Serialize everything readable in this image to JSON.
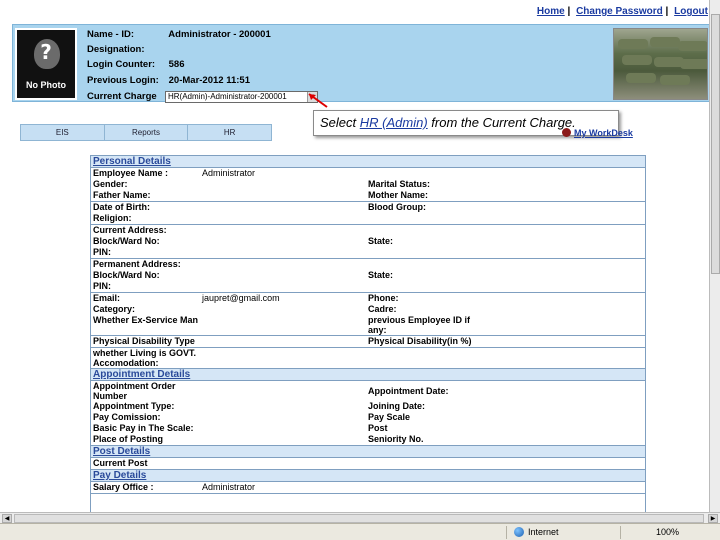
{
  "top_links": [
    "Home",
    "Change Password",
    "Logout"
  ],
  "header": {
    "photo_label": "No Photo",
    "photo_glyph": "?",
    "fields": [
      {
        "label": "Name - ID:",
        "value": "Administrator - 200001"
      },
      {
        "label": "Designation:",
        "value": ""
      },
      {
        "label": "Login Counter:",
        "value": "586"
      },
      {
        "label": "Previous Login:",
        "value": "20-Mar-2012 11:51"
      },
      {
        "label": "Current Charge",
        "value": ""
      }
    ],
    "charge_select_value": "HR(Admin)-Administrator-200001"
  },
  "callout": {
    "prefix": "Select ",
    "highlight": "HR (Admin)",
    "suffix": " from the Current Charge."
  },
  "tabs": [
    "EIS",
    "Reports",
    "HR"
  ],
  "my_desk": "My WorkDesk",
  "form": {
    "personal_title": "Personal Details",
    "appointment_title": "Appointment Details",
    "post_title": "Post Details",
    "pay_title": "Pay Details",
    "employee_name_label": "Employee Name :",
    "employee_name_value": "Administrator",
    "gender_label": "Gender:",
    "marital_label": "Marital Status:",
    "father_label": "Father Name:",
    "mother_label": "Mother Name:",
    "dob_label": "Date of Birth:",
    "blood_label": "Blood Group:",
    "religion_label": "Religion:",
    "cur_addr_label": "Current Address:",
    "cur_block_label": "Block/Ward No:",
    "cur_state_label": "State:",
    "cur_pin_label": "PIN:",
    "perm_addr_label": "Permanent Address:",
    "perm_block_label": "Block/Ward No:",
    "perm_state_label": "State:",
    "perm_pin_label": "PIN:",
    "email_label": "Email:",
    "email_value": "jaupret@gmail.com",
    "phone_label": "Phone:",
    "category_label": "Category:",
    "cadre_label": "Cadre:",
    "exservice_label": "Whether Ex-Service Man",
    "prev_emp_label": "previous Employee ID if any:",
    "disability_type_label": "Physical Disability Type",
    "disability_pct_label": "Physical Disability(in %)",
    "govt_accom_label": "whether Living is GOVT. Accomodation:",
    "appt_order_label": "Appointment Order Number",
    "appt_date_label": "Appointment Date:",
    "appt_type_label": "Appointment Type:",
    "joining_label": "Joining Date:",
    "pay_commission_label": "Pay Comission:",
    "pay_scale_label": "Pay Scale",
    "basic_pay_label": "Basic Pay in The Scale:",
    "post_label": "Post",
    "place_label": "Place of Posting",
    "seniority_label": "Seniority No.",
    "current_post_label": "Current Post",
    "salary_office_label": "Salary Office :",
    "salary_office_value": "Administrator"
  },
  "status_bar": {
    "zone": "Internet",
    "zoom": "100%"
  }
}
